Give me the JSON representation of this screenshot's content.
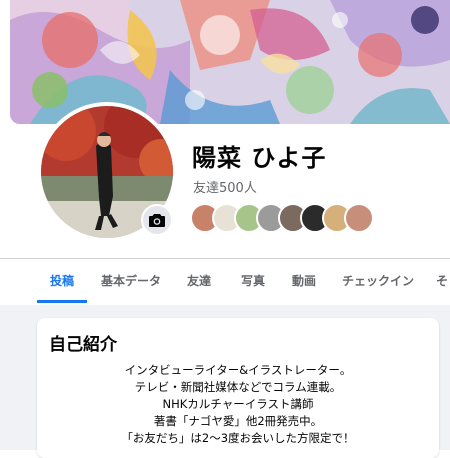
{
  "profile": {
    "name": "陽菜 ひよ子",
    "friends_count": "友達500人"
  },
  "tabs": [
    {
      "label": "投稿",
      "active": true
    },
    {
      "label": "基本データ"
    },
    {
      "label": "友達"
    },
    {
      "label": "写真"
    },
    {
      "label": "動画"
    },
    {
      "label": "チェックイン"
    },
    {
      "label": "そ"
    }
  ],
  "intro": {
    "title": "自己紹介",
    "bio_lines": [
      "インタビューライター&イラストレーター。",
      "テレビ・新聞社媒体などでコラム連載。",
      "NHKカルチャーイラスト講師",
      "著書「ナゴヤ愛」他2冊発売中。",
      "「お友だち」は2〜3度お会いした方限定で！"
    ]
  },
  "colors": {
    "accent": "#1877f2",
    "secondary_text": "#65676b",
    "feed_background": "#f0f2f5"
  },
  "icons": {
    "camera": "camera-icon"
  }
}
